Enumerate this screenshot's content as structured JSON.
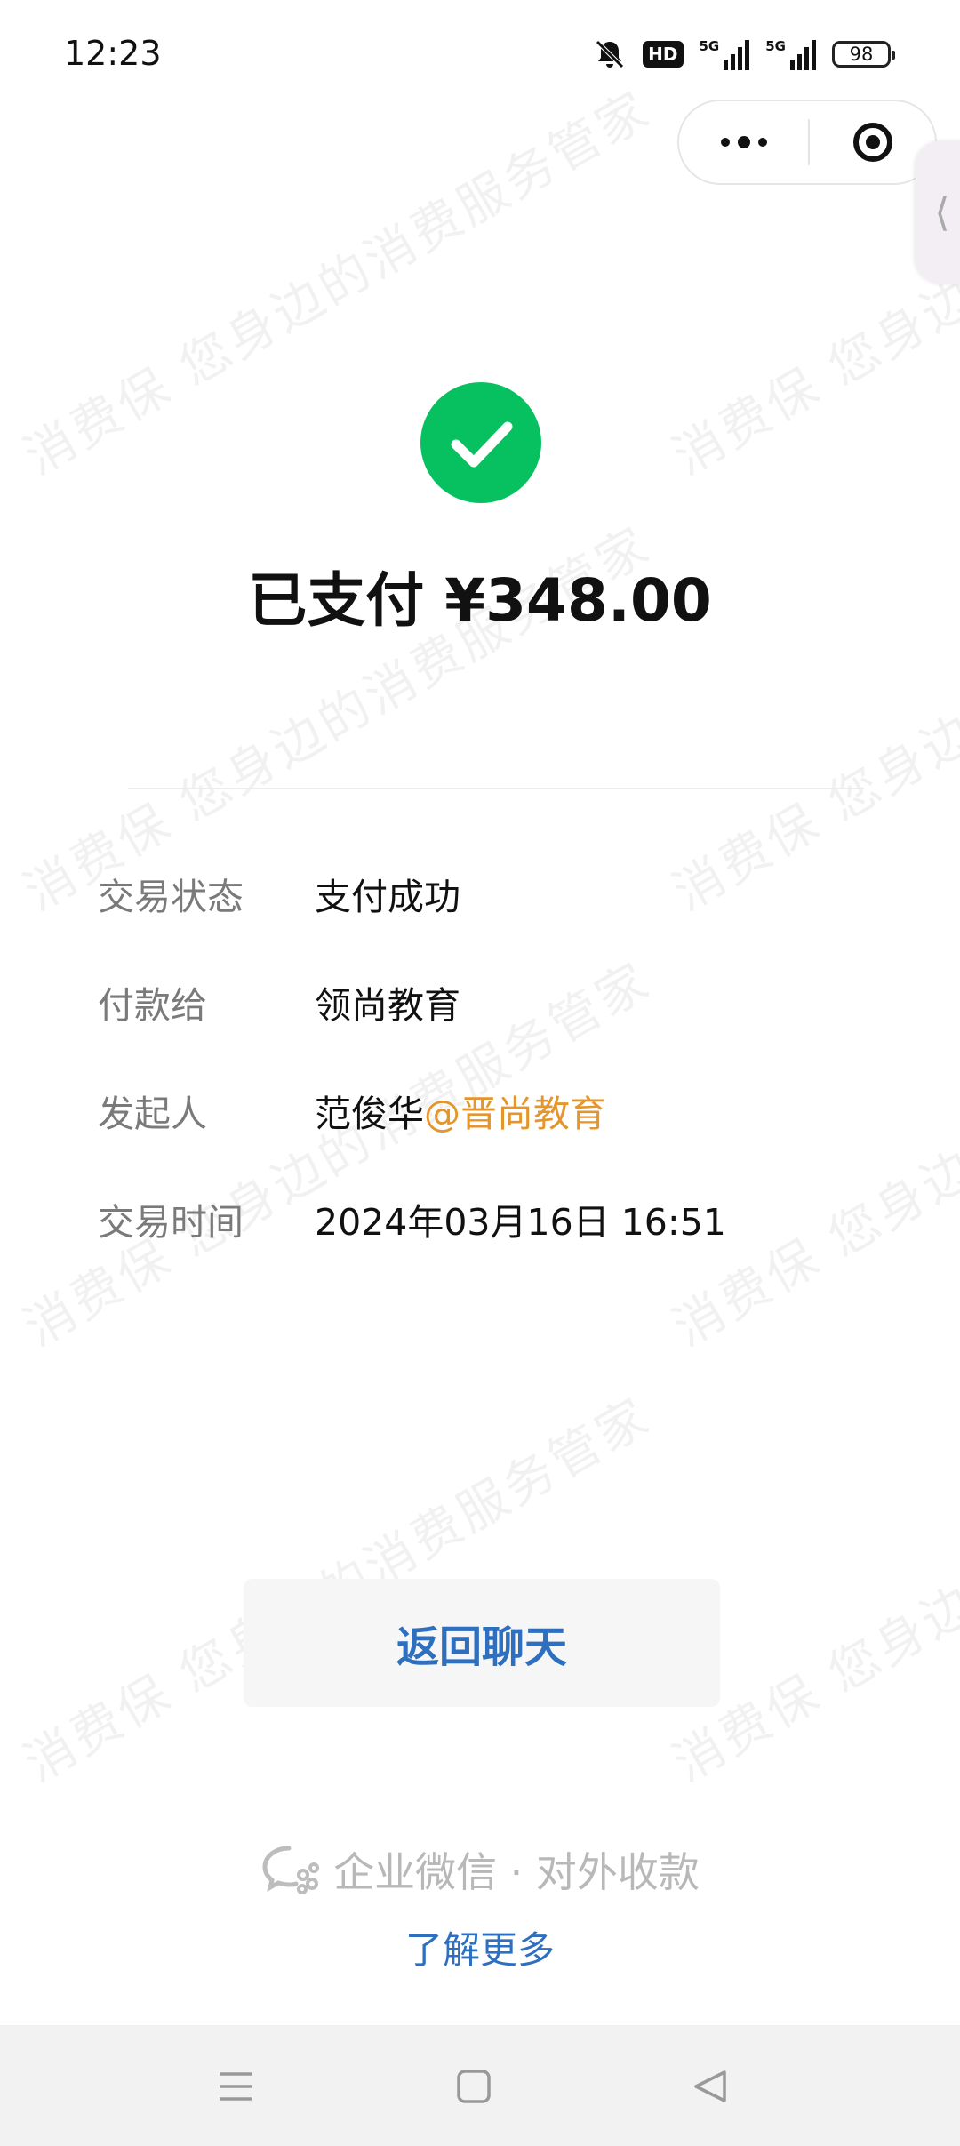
{
  "status_bar": {
    "time": "12:23",
    "hd_label": "HD",
    "signal1_tag": "5G",
    "signal2_tag": "5G",
    "battery": "98"
  },
  "capsule": {
    "more_icon": "more-dots-icon",
    "close_icon": "close-target-icon"
  },
  "side_tab": {
    "glyph": "⟨"
  },
  "watermark_text": "消费保 您身边的消费服务管家",
  "payment": {
    "title": "已支付 ¥348.00",
    "rows": [
      {
        "label": "交易状态",
        "value": "支付成功"
      },
      {
        "label": "付款给",
        "value": "领尚教育"
      },
      {
        "label": "发起人",
        "value": "范俊华",
        "extra": "@晋尚教育"
      },
      {
        "label": "交易时间",
        "value": "2024年03月16日 16:51"
      }
    ]
  },
  "actions": {
    "back_to_chat": "返回聊天"
  },
  "footer": {
    "brand_text": "企业微信 · 对外收款",
    "learn_more": "了解更多"
  },
  "colors": {
    "success_green": "#07c160",
    "link_blue": "#2f6fc0",
    "org_orange": "#e4962c"
  }
}
